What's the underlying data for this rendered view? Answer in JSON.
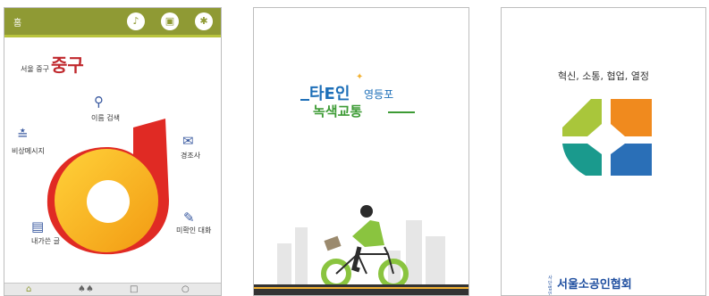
{
  "screen1": {
    "topbar": {
      "home_label": "홈",
      "icons": [
        "bell-icon",
        "window-icon",
        "gear-icon"
      ]
    },
    "logo_text_small": "서울 중구",
    "logo_text_big": "중구",
    "menu": [
      {
        "label": "이름 검색",
        "icon": "search-icon"
      },
      {
        "label": "비상메시지",
        "icon": "satellite-icon"
      },
      {
        "label": "경조사",
        "icon": "envelope-icon"
      },
      {
        "label": "내가쓴 글",
        "icon": "document-icon"
      },
      {
        "label": "미확인 대화",
        "icon": "chat-icon"
      }
    ],
    "bottom_nav": [
      "home-icon",
      "people-icon",
      "contact-icon",
      "chat-bubble-icon"
    ],
    "colors": {
      "topbar": "#8f9a34",
      "accent": "#b9c43d",
      "logo_red": "#e02a24",
      "logo_yellow": "#f5b21a"
    }
  },
  "screen2": {
    "title_main": "타E인",
    "title_sub": "영등포",
    "title_second": "녹색교통",
    "colors": {
      "blue": "#1d6fb8",
      "green": "#3d9b35",
      "lime": "#8ac43f"
    }
  },
  "screen3": {
    "slogan": "혁신, 소통, 협업, 열정",
    "org_prefix": "사단법인",
    "org_name": "서울소공인협회",
    "colors": {
      "lime": "#a9c63b",
      "orange": "#f08a1e",
      "teal": "#1a9a8d",
      "blue": "#2a6fb7"
    }
  }
}
